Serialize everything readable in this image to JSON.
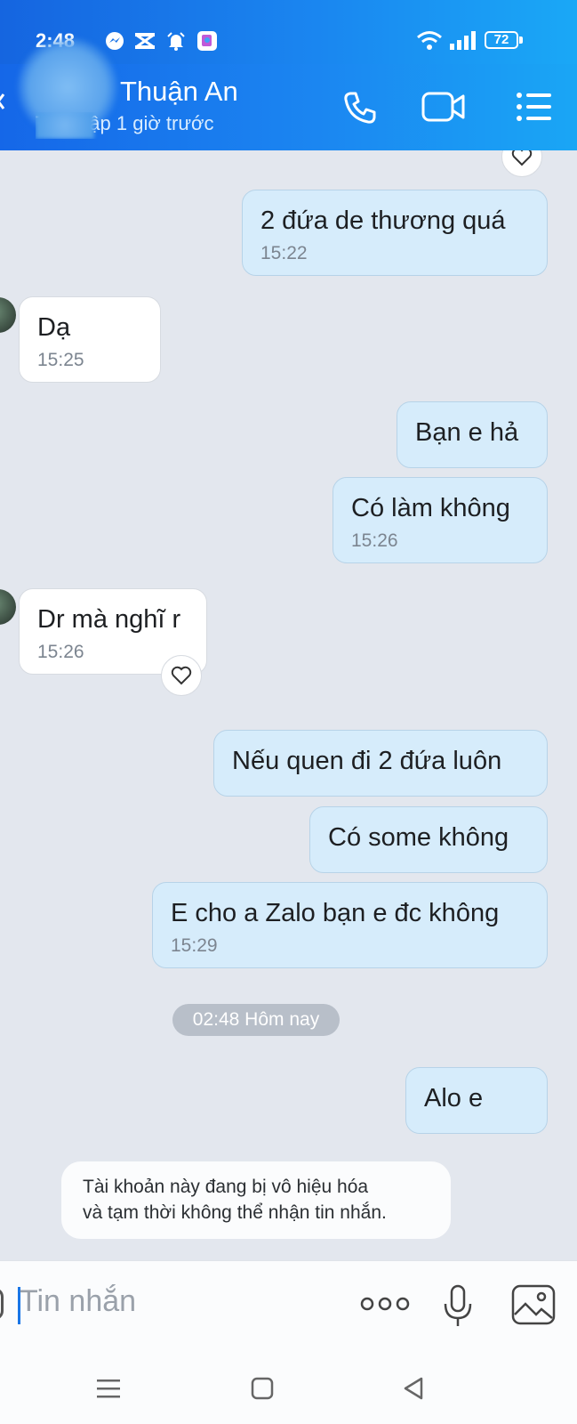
{
  "status_bar": {
    "time": "2:48",
    "battery": "72",
    "notification_icons": [
      "messenger-icon",
      "capcut-icon",
      "alarm-icon",
      "gallery-icon"
    ]
  },
  "header": {
    "contact_name": "Thuận An",
    "last_seen": "Truy cập 1 giờ trước",
    "actions": [
      "phone-icon",
      "video-call-icon",
      "menu-icon"
    ]
  },
  "messages": [
    {
      "dir": "out",
      "text": "2 đứa de thương quá",
      "time": "15:22"
    },
    {
      "dir": "in",
      "text": "Dạ",
      "time": "15:25"
    },
    {
      "dir": "out",
      "text": "Bạn e hả",
      "time": ""
    },
    {
      "dir": "out",
      "text": "Có làm không",
      "time": "15:26"
    },
    {
      "dir": "in",
      "text": "Dr mà nghĩ r",
      "time": "15:26"
    },
    {
      "dir": "out",
      "text": "Nếu quen đi 2 đứa luôn",
      "time": ""
    },
    {
      "dir": "out",
      "text": "Có some không",
      "time": ""
    },
    {
      "dir": "out",
      "text": "E cho a Zalo bạn e đc không",
      "time": "15:29"
    },
    {
      "dir": "out",
      "text": "Alo e",
      "time": ""
    }
  ],
  "day_separator": "02:48 Hôm nay",
  "notice": {
    "line1": "Tài khoản này đang bị vô hiệu hóa",
    "line2": "và tạm thời không thể nhận tin nhắn."
  },
  "composer": {
    "placeholder": "Tin nhắn",
    "actions": [
      "more-icon",
      "microphone-icon",
      "image-icon"
    ]
  },
  "nav_bar": [
    "recents-icon",
    "home-icon",
    "back-icon"
  ],
  "colors": {
    "header_start": "#1565e0",
    "header_end": "#1aa8f6",
    "outgoing_bubble": "#d6ecfb",
    "incoming_bubble": "#ffffff",
    "chat_background": "#e3e7ee",
    "accent": "#1976e6"
  }
}
